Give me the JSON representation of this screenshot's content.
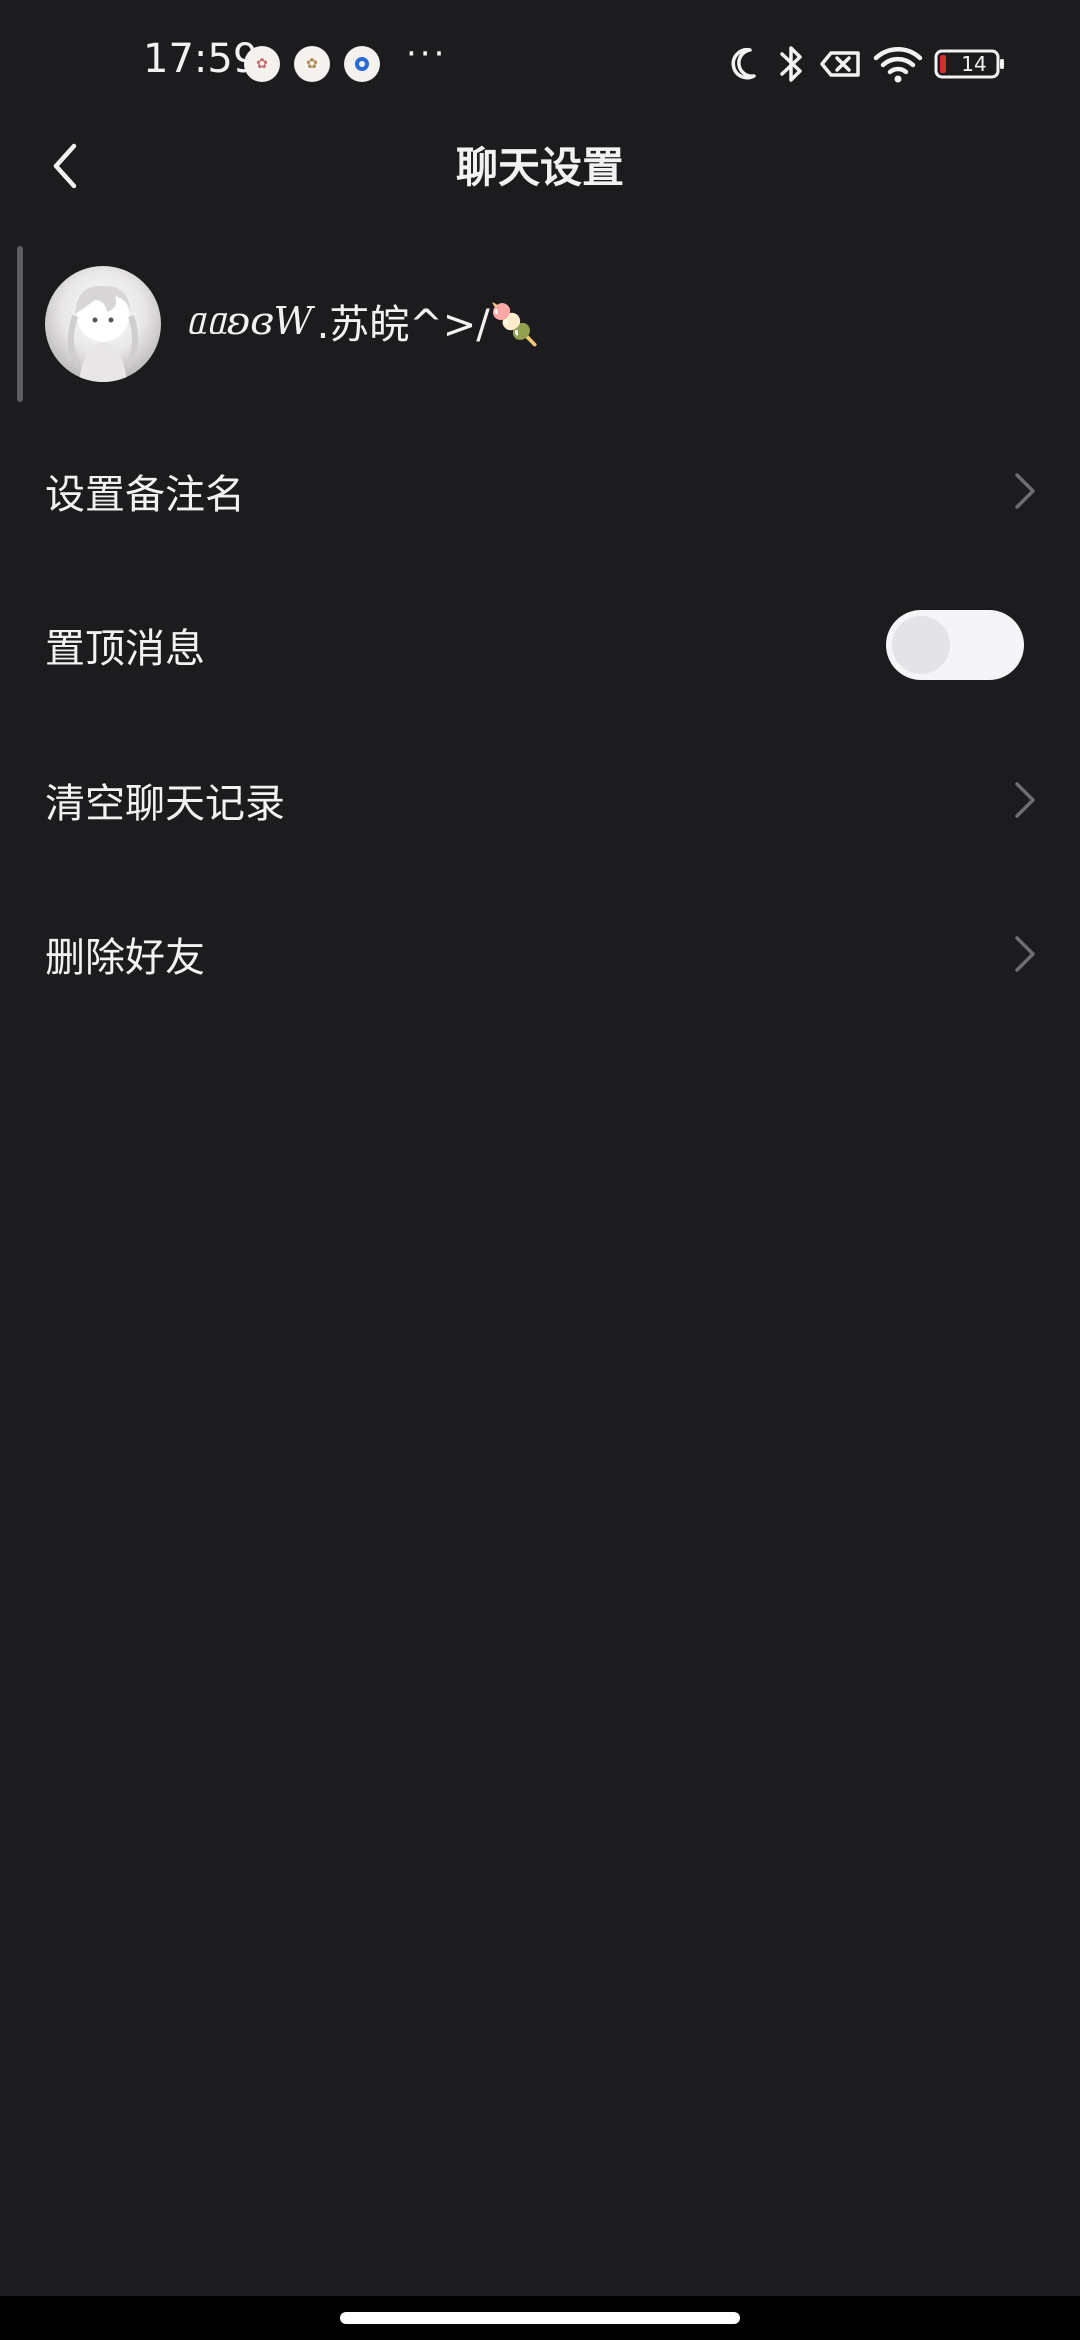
{
  "status_bar": {
    "time": "17:59",
    "more": "···",
    "battery_level": "14",
    "icons": [
      "moon-icon",
      "bluetooth-icon",
      "no-sim-icon",
      "wifi-icon",
      "battery-icon"
    ]
  },
  "header": {
    "title": "聊天设置",
    "back_icon": "chevron-left-icon"
  },
  "profile": {
    "name_script": "ᥲᥲʚɞW",
    "name_text": ".苏皖^>/🍡"
  },
  "menu": {
    "items": [
      {
        "label": "设置备注名",
        "control": "chevron"
      },
      {
        "label": "置顶消息",
        "control": "toggle",
        "toggle_on": false
      },
      {
        "label": "清空聊天记录",
        "control": "chevron"
      },
      {
        "label": "删除好友",
        "control": "chevron"
      }
    ]
  },
  "colors": {
    "background": "#1c1b1d",
    "text": "#f2f2f2",
    "chevron": "#6e6d72",
    "toggle_track": "#f5f4f6",
    "battery_low": "#d32f2f"
  }
}
